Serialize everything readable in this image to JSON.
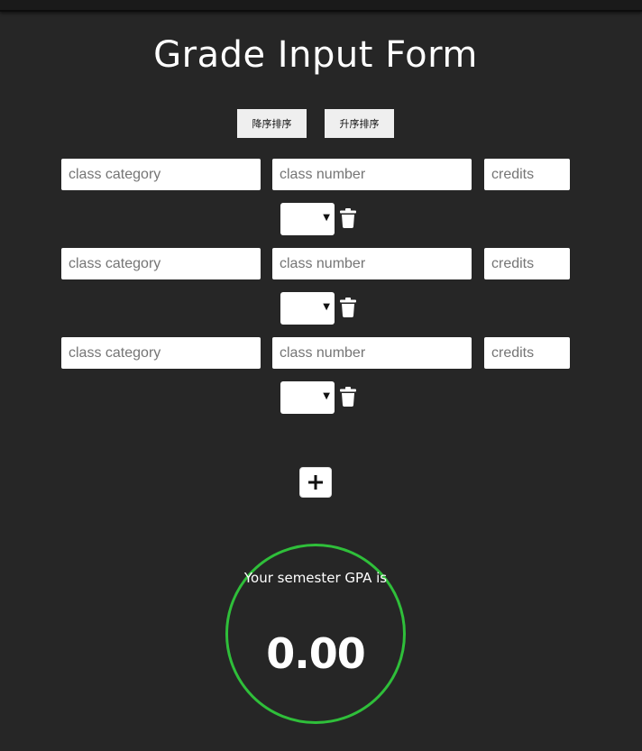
{
  "header": {
    "title": "Grade Input Form"
  },
  "sort": {
    "descending_label": "降序排序",
    "ascending_label": "升序排序"
  },
  "rows": [
    {
      "category_placeholder": "class category",
      "number_placeholder": "class number",
      "credits_placeholder": "credits",
      "grade_value": "",
      "delete_icon": "trash-icon"
    },
    {
      "category_placeholder": "class category",
      "number_placeholder": "class number",
      "credits_placeholder": "credits",
      "grade_value": "",
      "delete_icon": "trash-icon"
    },
    {
      "category_placeholder": "class category",
      "number_placeholder": "class number",
      "credits_placeholder": "credits",
      "grade_value": "",
      "delete_icon": "trash-icon"
    }
  ],
  "add_button": {
    "icon": "plus-icon"
  },
  "gpa": {
    "label": "Your semester GPA is",
    "value": "0.00",
    "ring_color": "#2fbf3a"
  },
  "colors": {
    "background": "#262626",
    "field": "#ffffff",
    "text": "#ffffff"
  }
}
